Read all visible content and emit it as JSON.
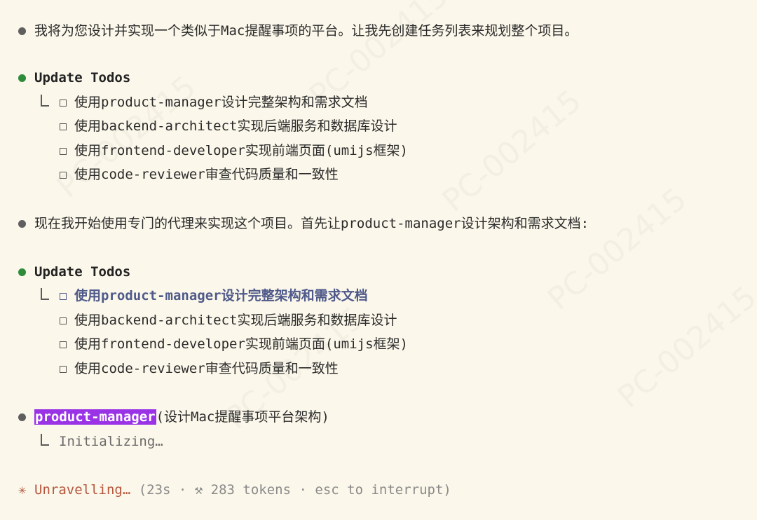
{
  "messages": {
    "intro": "我将为您设计并实现一个类似于Mac提醒事项的平台。让我先创建任务列表来规划整个项目。",
    "update1_title": "Update Todos",
    "todos1": [
      "使用product-manager设计完整架构和需求文档",
      "使用backend-architect实现后端服务和数据库设计",
      "使用frontend-developer实现前端页面(umijs框架)",
      "使用code-reviewer审查代码质量和一致性"
    ],
    "mid": "现在我开始使用专门的代理来实现这个项目。首先让product-manager设计架构和需求文档:",
    "update2_title": "Update Todos",
    "todos2": [
      "使用product-manager设计完整架构和需求文档",
      "使用backend-architect实现后端服务和数据库设计",
      "使用frontend-developer实现前端页面(umijs框架)",
      "使用code-reviewer审查代码质量和一致性"
    ],
    "agent_name": "product-manager",
    "agent_task": "(设计Mac提醒事项平台架构)",
    "agent_status": "Initializing…"
  },
  "status": {
    "star": "✳",
    "label": "Unravelling…",
    "meta": " (23s · ⚒ 283 tokens · esc to interrupt)"
  },
  "watermark": "PC-002415",
  "colors": {
    "background": "#fbf7ea",
    "bullet_green": "#2e8b3a",
    "agent_tag": "#9a33e6",
    "active_todo": "#4f5a8a",
    "status": "#b5563d"
  }
}
